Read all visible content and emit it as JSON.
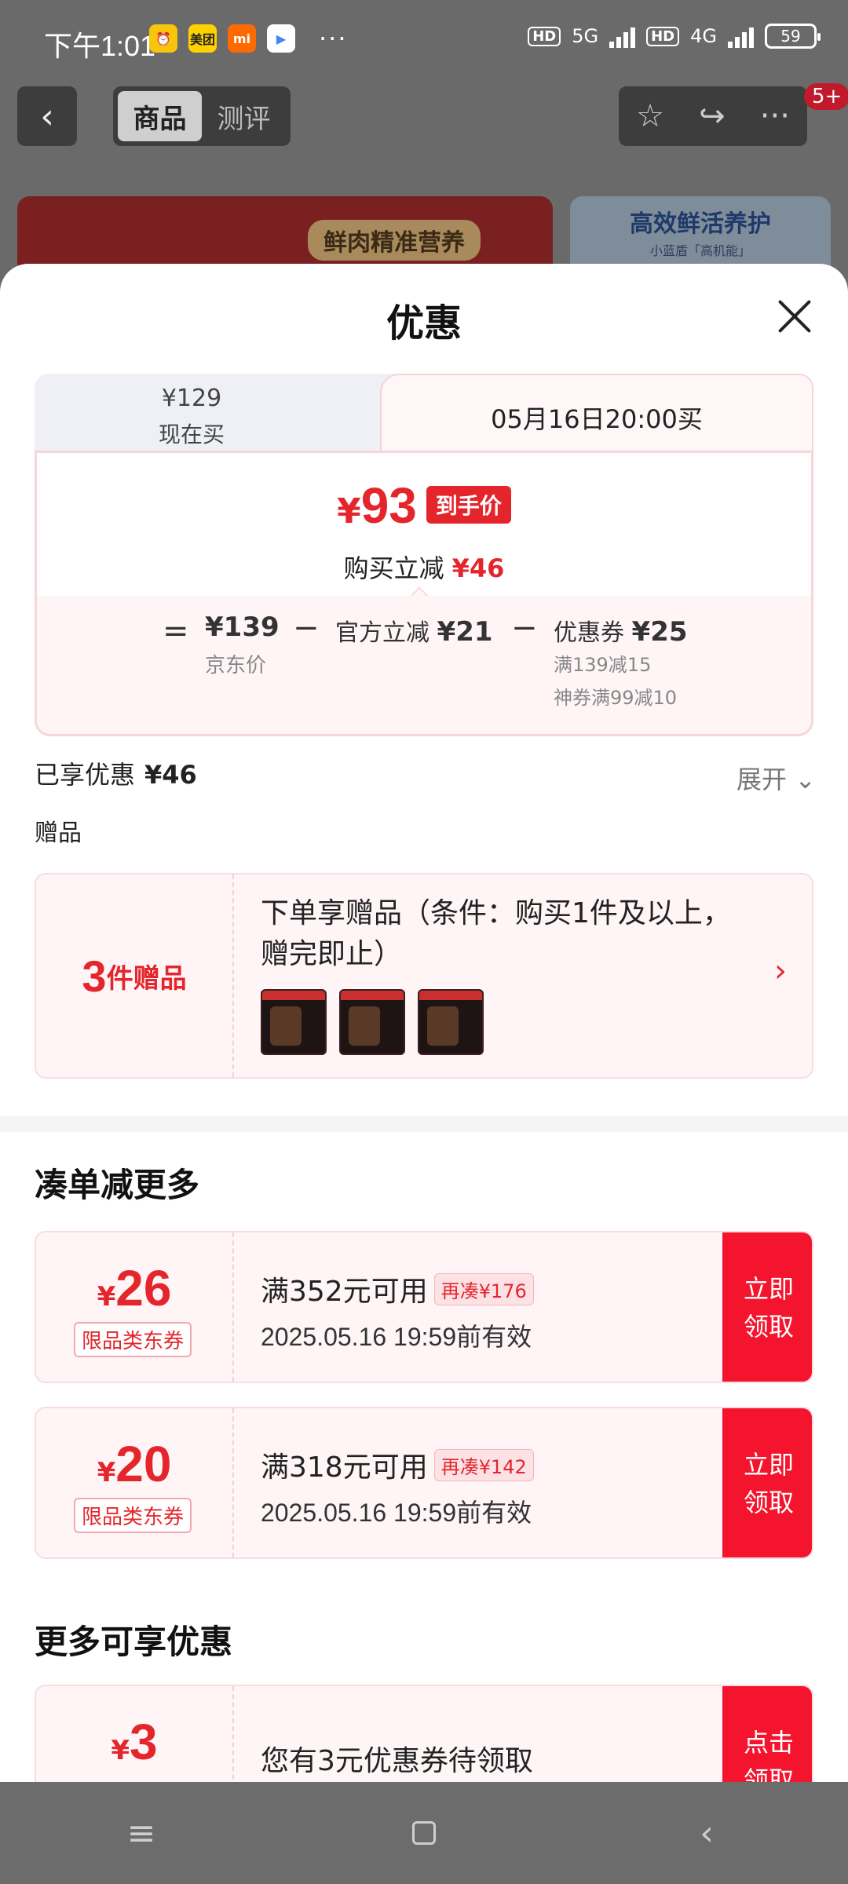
{
  "status_bar": {
    "time": "下午1:01",
    "apps": [
      "美团",
      "mi"
    ],
    "more": "···",
    "hd1": "HD",
    "net1": "5G",
    "hd2": "HD",
    "net2": "4G",
    "battery": "59"
  },
  "top_nav": {
    "back_icon": "‹",
    "tabs": [
      "商品",
      "测评"
    ],
    "badge": "5+"
  },
  "background": {
    "banner_left_text": "鲜肉精准营养",
    "banner_right_title": "高效鲜活养护",
    "banner_right_sub": "小蓝盾「高机能」"
  },
  "sheet": {
    "title": "优惠",
    "price_tabs": {
      "now_price": "¥129",
      "now_label": "现在买",
      "future_label": "05月16日20:00买"
    },
    "final": {
      "yen": "¥",
      "amount": "93",
      "tag": "到手价",
      "save_label": "购买立减",
      "save_amount": "¥46"
    },
    "formula": {
      "eq": "=",
      "jd_price": "¥139",
      "jd_label": "京东价",
      "minus": "−",
      "official_label": "官方立减",
      "official_amount": "¥21",
      "coupon_label": "优惠券",
      "coupon_amount": "¥25",
      "coupon_line1": "满139减15",
      "coupon_line2": "神券满99减10"
    },
    "enjoyed_label": "已享优惠",
    "enjoyed_amount": "¥46",
    "expand_label": "展开",
    "gifts_label": "赠品",
    "gift": {
      "count": "3",
      "unit": "件赠品",
      "title": "下单享赠品（条件：购买1件及以上，赠完即止）"
    },
    "section_combine": "凑单减更多",
    "coupons": [
      {
        "yen": "¥",
        "amount": "26",
        "type": "限品类东券",
        "condition": "满352元可用",
        "more": "再凑¥176",
        "valid": "2025.05.16 19:59前有效",
        "button": "立即领取"
      },
      {
        "yen": "¥",
        "amount": "20",
        "type": "限品类东券",
        "condition": "满318元可用",
        "more": "再凑¥142",
        "valid": "2025.05.16 19:59前有效",
        "button": "立即领取"
      }
    ],
    "section_more": "更多可享优惠",
    "extra_coupon": {
      "yen": "¥",
      "amount": "3",
      "text": "您有3元优惠券待领取",
      "button": "点击领取"
    }
  },
  "colors": {
    "accent": "#e4262c",
    "button_red": "#f5142d",
    "card_bg": "#fff5f6"
  }
}
